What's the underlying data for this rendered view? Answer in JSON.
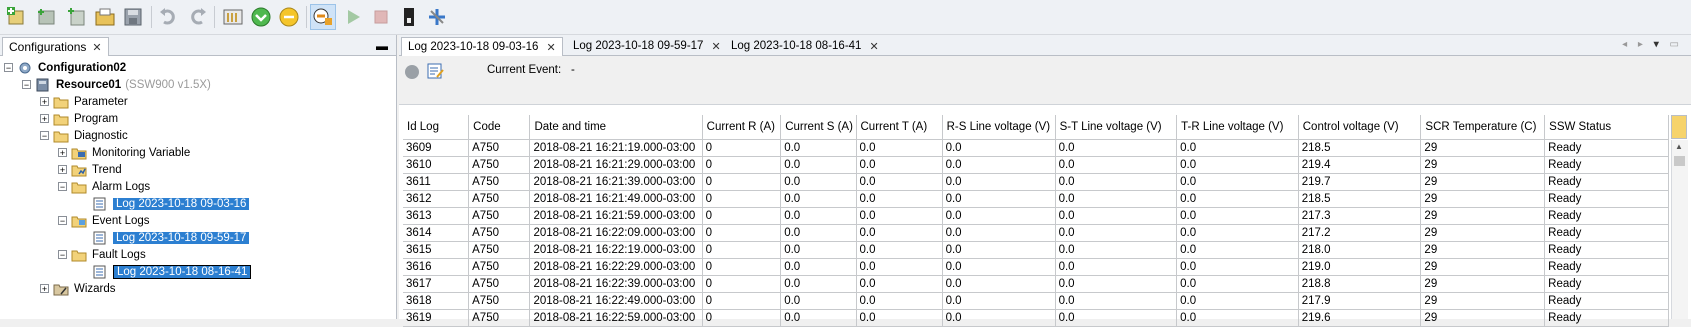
{
  "toolbar": {
    "buttons": [
      "new-project",
      "new-folder",
      "add-item",
      "open-folder",
      "save",
      "undo",
      "redo",
      "properties",
      "go-online",
      "go-offline",
      "connect",
      "run",
      "stop",
      "switch",
      "tools"
    ],
    "accent": "#2c7fd1"
  },
  "left_panel": {
    "tab_title": "Configurations",
    "close_glyph": "✕",
    "minimize_glyph": "▬",
    "tree": {
      "configuration": "Configuration02",
      "resource": "Resource01",
      "resource_version": "(SSW900 v1.5X)",
      "parameter": "Parameter",
      "program": "Program",
      "diagnostic": "Diagnostic",
      "monitoring_variable": "Monitoring Variable",
      "trend": "Trend",
      "alarm_logs": "Alarm Logs",
      "alarm_log_item": "Log 2023-10-18 09-03-16",
      "event_logs": "Event Logs",
      "event_log_item": "Log 2023-10-18 09-59-17",
      "fault_logs": "Fault Logs",
      "fault_log_item": "Log 2023-10-18 08-16-41",
      "wizards": "Wizards"
    }
  },
  "right_panel": {
    "tabs": [
      {
        "label": "Log 2023-10-18 09-03-16",
        "active": true
      },
      {
        "label": "Log 2023-10-18 09-59-17",
        "active": false
      },
      {
        "label": "Log 2023-10-18 08-16-41",
        "active": false
      }
    ],
    "close_glyph": "✕",
    "current_event_label": "Current Event:",
    "current_event_value": "-",
    "columns": [
      "Id Log",
      "Code",
      "Date and time",
      "Current R (A)",
      "Current S (A)",
      "Current T (A)",
      "R-S Line voltage (V)",
      "S-T Line voltage (V)",
      "T-R Line voltage (V)",
      "Control voltage (V)",
      "SCR Temperature (C)",
      "SSW Status"
    ],
    "rows": [
      [
        "3609",
        "A750",
        "2018-08-21 16:21:19.000-03:00",
        "0",
        "0.0",
        "0.0",
        "0.0",
        "0.0",
        "0.0",
        "218.5",
        "29",
        "Ready"
      ],
      [
        "3610",
        "A750",
        "2018-08-21 16:21:29.000-03:00",
        "0",
        "0.0",
        "0.0",
        "0.0",
        "0.0",
        "0.0",
        "219.4",
        "29",
        "Ready"
      ],
      [
        "3611",
        "A750",
        "2018-08-21 16:21:39.000-03:00",
        "0",
        "0.0",
        "0.0",
        "0.0",
        "0.0",
        "0.0",
        "219.7",
        "29",
        "Ready"
      ],
      [
        "3612",
        "A750",
        "2018-08-21 16:21:49.000-03:00",
        "0",
        "0.0",
        "0.0",
        "0.0",
        "0.0",
        "0.0",
        "218.5",
        "29",
        "Ready"
      ],
      [
        "3613",
        "A750",
        "2018-08-21 16:21:59.000-03:00",
        "0",
        "0.0",
        "0.0",
        "0.0",
        "0.0",
        "0.0",
        "217.3",
        "29",
        "Ready"
      ],
      [
        "3614",
        "A750",
        "2018-08-21 16:22:09.000-03:00",
        "0",
        "0.0",
        "0.0",
        "0.0",
        "0.0",
        "0.0",
        "217.2",
        "29",
        "Ready"
      ],
      [
        "3615",
        "A750",
        "2018-08-21 16:22:19.000-03:00",
        "0",
        "0.0",
        "0.0",
        "0.0",
        "0.0",
        "0.0",
        "218.0",
        "29",
        "Ready"
      ],
      [
        "3616",
        "A750",
        "2018-08-21 16:22:29.000-03:00",
        "0",
        "0.0",
        "0.0",
        "0.0",
        "0.0",
        "0.0",
        "219.0",
        "29",
        "Ready"
      ],
      [
        "3617",
        "A750",
        "2018-08-21 16:22:39.000-03:00",
        "0",
        "0.0",
        "0.0",
        "0.0",
        "0.0",
        "0.0",
        "218.8",
        "29",
        "Ready"
      ],
      [
        "3618",
        "A750",
        "2018-08-21 16:22:49.000-03:00",
        "0",
        "0.0",
        "0.0",
        "0.0",
        "0.0",
        "0.0",
        "217.9",
        "29",
        "Ready"
      ],
      [
        "3619",
        "A750",
        "2018-08-21 16:22:59.000-03:00",
        "0",
        "0.0",
        "0.0",
        "0.0",
        "0.0",
        "0.0",
        "219.6",
        "29",
        "Ready"
      ]
    ]
  }
}
